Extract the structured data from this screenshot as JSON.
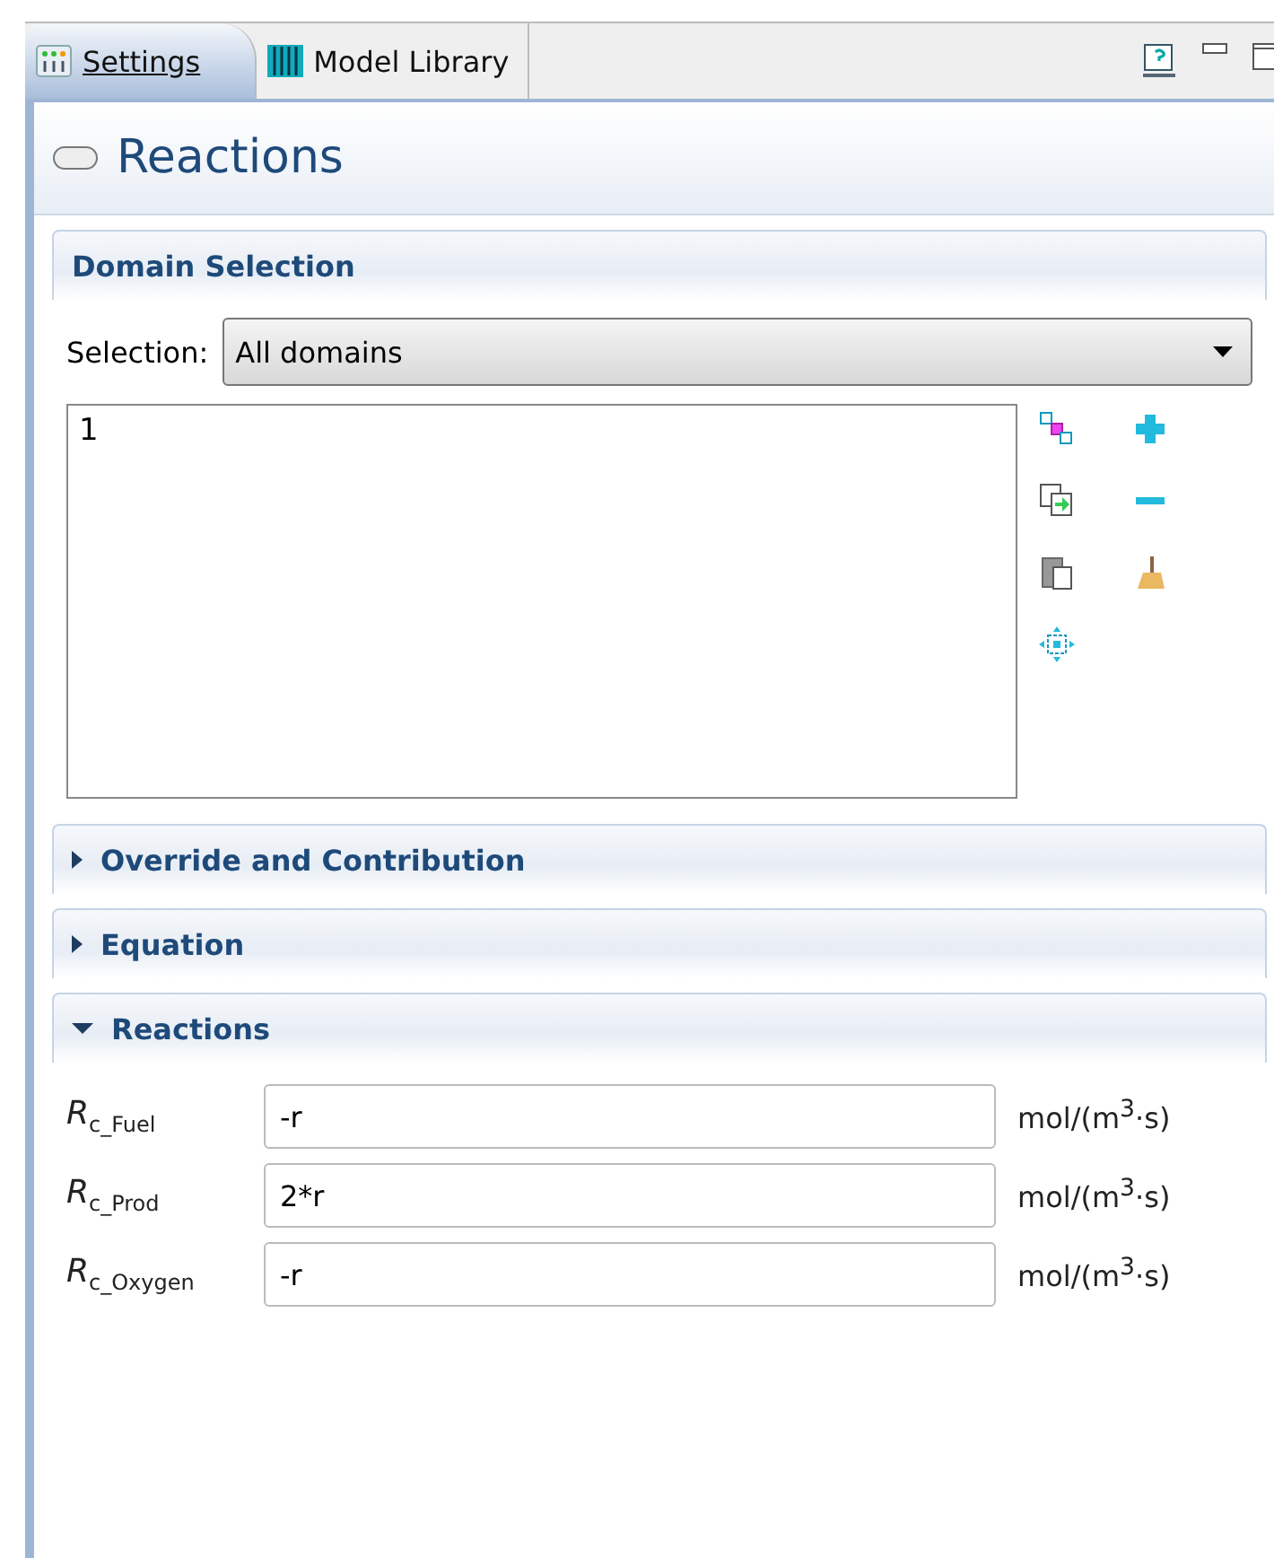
{
  "tabs": [
    {
      "label": "Settings",
      "kind": "settings",
      "selected": true
    },
    {
      "label": "Model Library",
      "kind": "library",
      "selected": false
    }
  ],
  "title": "Reactions",
  "sections": [
    {
      "kind": "selection",
      "title": "Domain Selection",
      "selection_label": "Selection:",
      "selection_value": "All domains",
      "list_items": [
        "1"
      ]
    },
    {
      "kind": "plain",
      "title": "Override and Contribution",
      "expanded": false
    },
    {
      "kind": "plain",
      "title": "Equation",
      "expanded": false
    },
    {
      "kind": "fields",
      "title": "Reactions",
      "expanded": true,
      "fields": [
        {
          "label": "*R*$_{c_Fuel}$",
          "value": "-r",
          "unit": "mol/(m$^{3}$·s)"
        },
        {
          "label": "*R*$_{c_Prod}$",
          "value": "2*r",
          "unit": "mol/(m$^{3}$·s)"
        },
        {
          "label": "*R*$_{c_Oxygen}$",
          "value": "-r",
          "unit": "mol/(m$^{3}$·s)"
        }
      ]
    }
  ]
}
